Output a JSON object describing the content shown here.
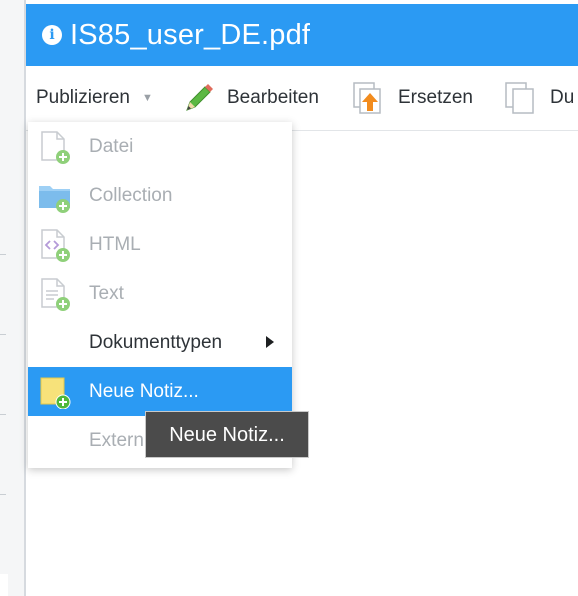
{
  "title_bar": {
    "icon": "info-icon",
    "title": "IS85_user_DE.pdf"
  },
  "toolbar": {
    "publish_label": "Publizieren",
    "edit_label": "Bearbeiten",
    "replace_label": "Ersetzen",
    "duplicate_label": "Du"
  },
  "menu": {
    "items": [
      {
        "label": "Datei",
        "icon": "file-add-icon",
        "state": "disabled"
      },
      {
        "label": "Collection",
        "icon": "folder-add-icon",
        "state": "disabled"
      },
      {
        "label": "HTML",
        "icon": "html-file-add-icon",
        "state": "disabled"
      },
      {
        "label": "Text",
        "icon": "text-file-add-icon",
        "state": "disabled"
      },
      {
        "label": "Dokumenttypen",
        "icon": "",
        "state": "enabled",
        "has_submenu": true
      },
      {
        "label": "Neue Notiz...",
        "icon": "note-add-icon",
        "state": "highlighted"
      },
      {
        "label": "Extern",
        "icon": "",
        "state": "disabled"
      }
    ]
  },
  "tooltip": {
    "text": "Neue Notiz..."
  },
  "colors": {
    "accent": "#2b9af3",
    "disabled_text": "#a9aeb3",
    "tooltip_bg": "#4b4b4b"
  }
}
